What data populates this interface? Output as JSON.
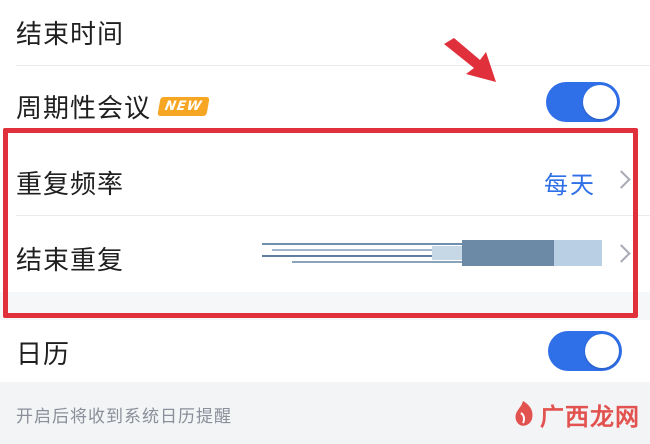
{
  "settings": {
    "end_time_label": "结束时间",
    "recurring_label": "周期性会议",
    "new_badge": "NEW",
    "recurring_enabled": true,
    "frequency_label": "重复频率",
    "frequency_value": "每天",
    "end_repeat_label": "结束重复",
    "calendar_label": "日历",
    "calendar_enabled": true,
    "calendar_hint": "开启后将收到系统日历提醒"
  },
  "watermark": {
    "text": "广西龙网"
  },
  "colors": {
    "accent": "#2f6fe8",
    "highlight": "#e0303c",
    "badge": "#f6a623"
  }
}
